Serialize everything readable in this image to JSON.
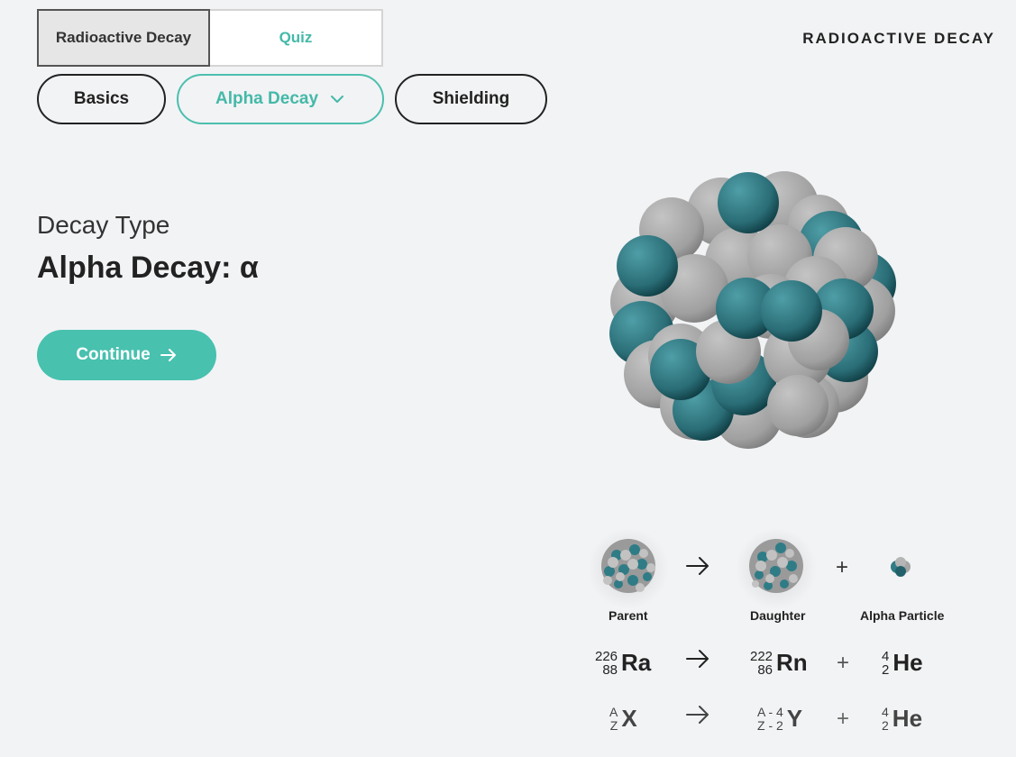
{
  "tabs": [
    {
      "label": "Radioactive Decay",
      "active": true
    },
    {
      "label": "Quiz",
      "active": false
    }
  ],
  "app_title": "RADIOACTIVE DECAY",
  "nav_pills": {
    "basics": "Basics",
    "alpha": "Alpha Decay",
    "shielding": "Shielding"
  },
  "main": {
    "label": "Decay Type",
    "title": "Alpha Decay: α",
    "continue_label": "Continue"
  },
  "diagram": {
    "parent_caption": "Parent",
    "daughter_caption": "Daughter",
    "alpha_caption": "Alpha Particle",
    "row1": {
      "parent": {
        "mass": "226",
        "atomic": "88",
        "symbol": "Ra"
      },
      "daughter": {
        "mass": "222",
        "atomic": "86",
        "symbol": "Rn"
      },
      "alpha": {
        "mass": "4",
        "atomic": "2",
        "symbol": "He"
      }
    },
    "row2": {
      "parent": {
        "mass": "A",
        "atomic": "Z",
        "symbol": "X"
      },
      "daughter": {
        "mass": "A - 4",
        "atomic": "Z - 2",
        "symbol": "Y"
      },
      "alpha": {
        "mass": "4",
        "atomic": "2",
        "symbol": "He"
      }
    },
    "plus": "+"
  },
  "colors": {
    "accent": "#48c1af",
    "proton": "#2f7c86",
    "neutron": "#a7a7a7",
    "background": "#f2f3f5"
  },
  "icons": {
    "arrow": "right-arrow-icon",
    "chevron": "chevron-down-icon"
  }
}
